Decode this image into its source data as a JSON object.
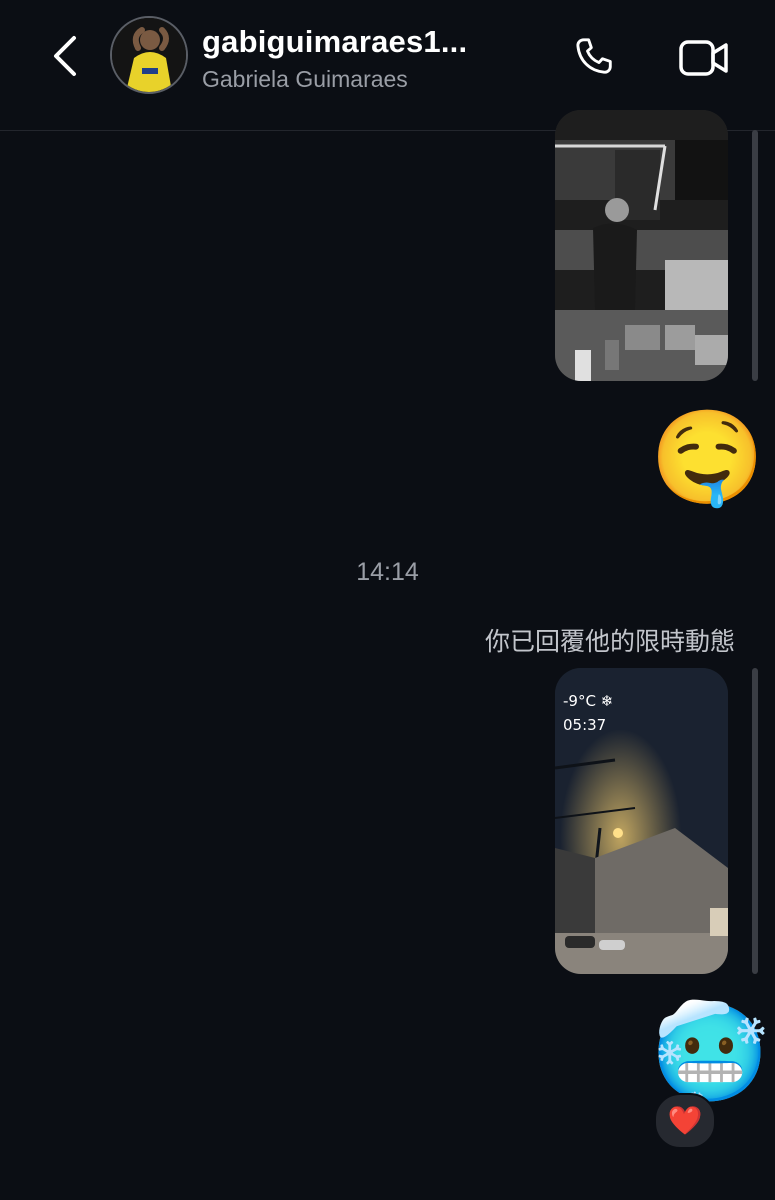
{
  "header": {
    "username": "gabiguimaraes1...",
    "display_name": "Gabriela Guimaraes",
    "back_icon": "chevron-left-icon",
    "call_icon": "phone-icon",
    "video_icon": "video-camera-icon"
  },
  "messages": {
    "timestamp": "14:14",
    "story_reply_notice": "你已回覆他的限時動態",
    "story_overlay": {
      "temperature": "-9°C ❄",
      "time": "05:37"
    },
    "emoji_drooling": "🤤",
    "emoji_cold": "🥶",
    "reaction": "❤️"
  },
  "colors": {
    "background": "#0b0e14",
    "secondary_text": "#9a9ea6",
    "divider": "#23262d"
  }
}
